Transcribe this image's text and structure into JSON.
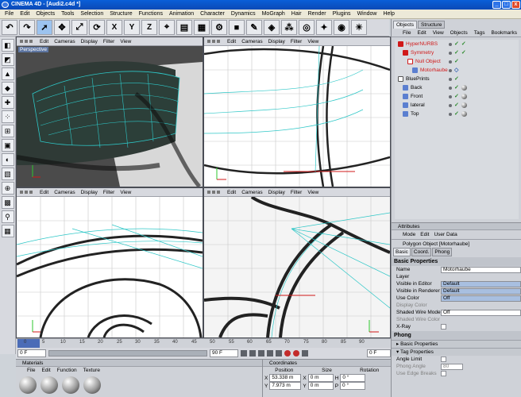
{
  "window": {
    "title": "CINEMA 4D - [Audi2.c4d *]"
  },
  "menubar": [
    "File",
    "Edit",
    "Objects",
    "Tools",
    "Selection",
    "Structure",
    "Functions",
    "Animation",
    "Character",
    "Dynamics",
    "MoGraph",
    "Hair",
    "Render",
    "Plugins",
    "Window",
    "Help"
  ],
  "toolbar": {
    "axis_labels": [
      "X",
      "Y",
      "Z"
    ]
  },
  "viewports": {
    "menu": [
      "Edit",
      "Cameras",
      "Display",
      "Filter",
      "View"
    ],
    "perspective_label": "Perspective"
  },
  "object_manager": {
    "tabs": [
      "Objects",
      "Structure"
    ],
    "menu": [
      "File",
      "Edit",
      "View",
      "Objects",
      "Tags",
      "Bookmarks"
    ],
    "items": [
      {
        "name": "HyperNURBS",
        "indent": 0,
        "red": true
      },
      {
        "name": "Symmetry",
        "indent": 1,
        "red": true
      },
      {
        "name": "Null Object",
        "indent": 2,
        "red": true
      },
      {
        "name": "Motorhaube",
        "indent": 3,
        "red": true
      },
      {
        "name": "BluePrints",
        "indent": 0,
        "red": false
      },
      {
        "name": "Back",
        "indent": 1,
        "red": false
      },
      {
        "name": "Front",
        "indent": 1,
        "red": false
      },
      {
        "name": "lateral",
        "indent": 1,
        "red": false
      },
      {
        "name": "Top",
        "indent": 1,
        "red": false
      }
    ]
  },
  "attributes": {
    "title": "Attributes",
    "menu": [
      "Mode",
      "Edit",
      "User Data"
    ],
    "object_title": "Polygon Object [Motorhaube]",
    "tabs": [
      "Basic",
      "Coord.",
      "Phong"
    ],
    "basic_section": "Basic Properties",
    "props": [
      {
        "label": "Name",
        "value": "Motorhaube",
        "disabled": false,
        "kind": "field"
      },
      {
        "label": "Layer",
        "value": "",
        "disabled": false,
        "kind": "empty"
      },
      {
        "label": "Visible in Editor",
        "value": "Default",
        "disabled": false,
        "kind": "select"
      },
      {
        "label": "Visible in Renderer",
        "value": "Default",
        "disabled": false,
        "kind": "select"
      },
      {
        "label": "Use Color",
        "value": "Off",
        "disabled": false,
        "kind": "select"
      },
      {
        "label": "Display Color",
        "value": "",
        "disabled": true,
        "kind": "empty"
      },
      {
        "label": "Shaded Wire Mode",
        "value": "Off",
        "disabled": false,
        "kind": "field"
      },
      {
        "label": "Shaded Wire Color",
        "value": "",
        "disabled": true,
        "kind": "empty"
      },
      {
        "label": "X-Ray",
        "value": "",
        "disabled": false,
        "kind": "check"
      }
    ],
    "phong_section": "Phong",
    "phong_sub1": "Basic Properties",
    "phong_sub2": "Tag Properties",
    "phong_props": [
      {
        "label": "Angle Limit",
        "value": "",
        "disabled": false,
        "kind": "check"
      },
      {
        "label": "Phong Angle",
        "value": "80",
        "disabled": true,
        "kind": "field"
      },
      {
        "label": "Use Edge Breaks",
        "value": "",
        "disabled": true,
        "kind": "check"
      }
    ]
  },
  "timeline": {
    "ticks": [
      "0",
      "5",
      "10",
      "15",
      "20",
      "25",
      "30",
      "35",
      "40",
      "45",
      "50",
      "55",
      "60",
      "65",
      "70",
      "75",
      "80",
      "85",
      "90"
    ],
    "current_frame": "0 F",
    "end_field": "0 F",
    "end_frame": "90 F"
  },
  "materials": {
    "title": "Materials",
    "menu": [
      "File",
      "Edit",
      "Function",
      "Texture"
    ]
  },
  "coordinates": {
    "title": "Coordinates",
    "headers": [
      "Position",
      "Size",
      "Rotation"
    ],
    "rows": [
      {
        "axis": "X",
        "position": "53.338 m",
        "size_axis": "X",
        "size": "0 m",
        "rot_axis": "H",
        "rotation": "0 °"
      },
      {
        "axis": "Y",
        "position": "7.973 m",
        "size_axis": "Y",
        "size": "0 m",
        "rot_axis": "P",
        "rotation": "0 °"
      }
    ]
  },
  "colors": {
    "wire_cyan": "#2ec7c7",
    "selection_red": "#d01919",
    "accent_blue": "#0b49b6"
  }
}
